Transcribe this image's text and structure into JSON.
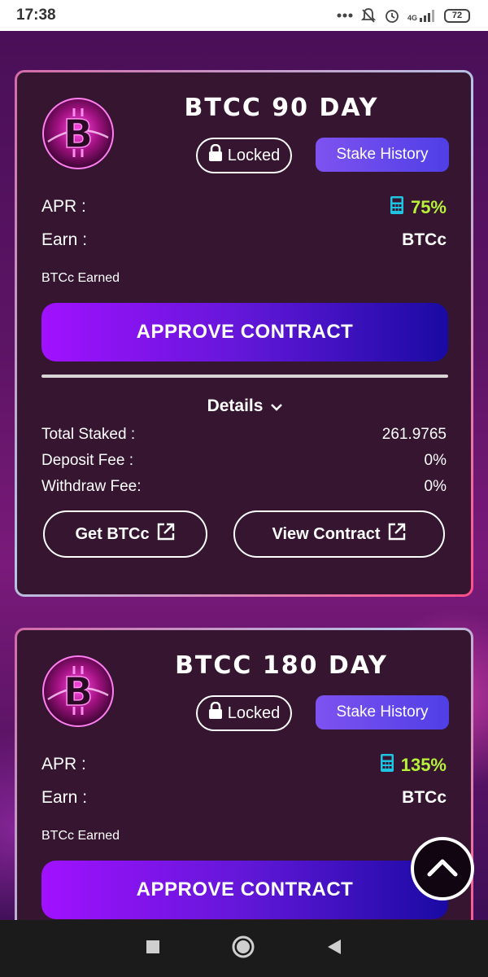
{
  "status_bar": {
    "time": "17:38",
    "network": "4G",
    "battery": "72",
    "icons": [
      "more-dots-icon",
      "bell-off-icon",
      "alarm-icon",
      "signal-icon",
      "battery-icon"
    ]
  },
  "colors": {
    "card_bg": "#35152f",
    "apr_green": "#b6f23a",
    "stake_history_start": "#7e52f0",
    "approve_start": "#a111ff",
    "approve_end": "#1a0aa3"
  },
  "cards": [
    {
      "title": "BTCC 90 DAY",
      "locked_label": "Locked",
      "stake_history_label": "Stake History",
      "apr_label": "APR :",
      "apr_value": "75%",
      "earn_label": "Earn :",
      "earn_value": "BTCc",
      "earned_label": "BTCc Earned",
      "approve_label": "APPROVE CONTRACT",
      "details_label": "Details",
      "total_staked_label": "Total Staked :",
      "total_staked_value": "261.9765",
      "deposit_fee_label": "Deposit Fee :",
      "deposit_fee_value": "0%",
      "withdraw_fee_label": "Withdraw Fee:",
      "withdraw_fee_value": "0%",
      "get_label": "Get BTCc",
      "view_contract_label": "View Contract"
    },
    {
      "title": "BTCC 180 DAY",
      "locked_label": "Locked",
      "stake_history_label": "Stake History",
      "apr_label": "APR :",
      "apr_value": "135%",
      "earn_label": "Earn :",
      "earn_value": "BTCc",
      "earned_label": "BTCc Earned",
      "approve_label": "APPROVE CONTRACT"
    }
  ]
}
